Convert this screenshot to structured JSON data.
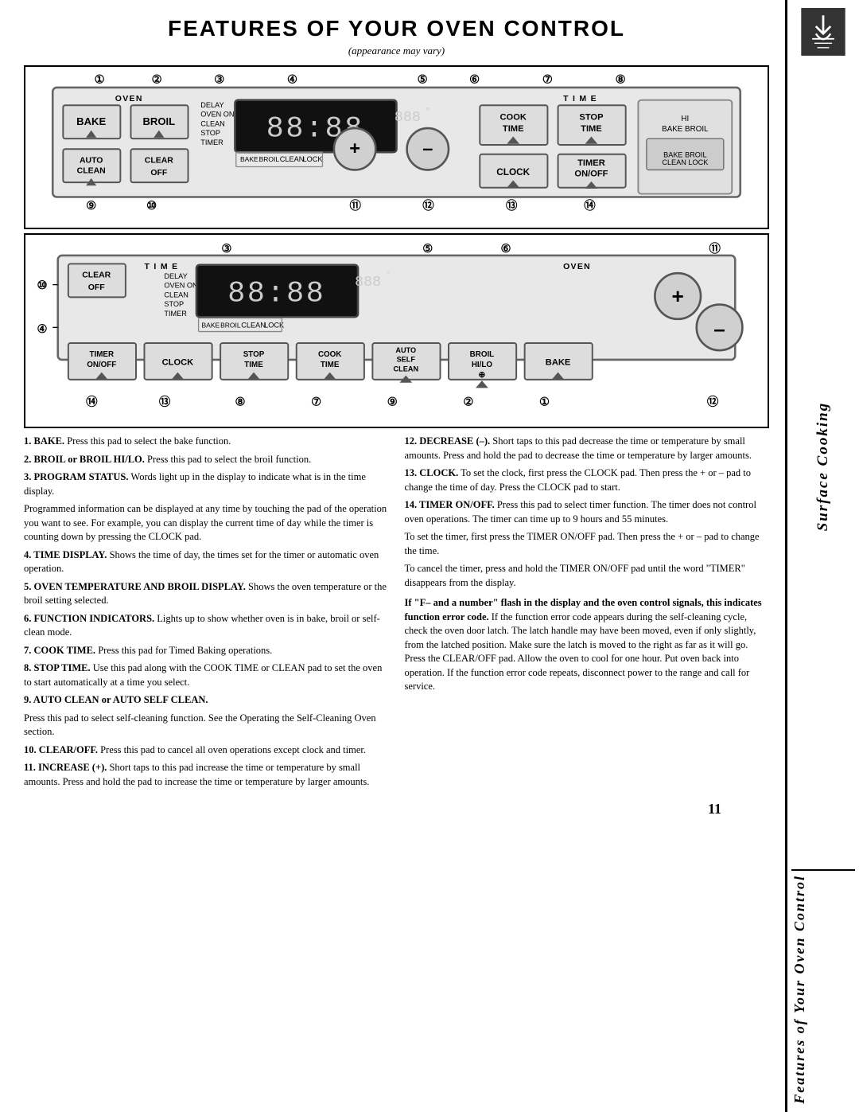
{
  "title": "FEATURES OF YOUR OVEN CONTROL",
  "subtitle": "(appearance may vary)",
  "sidebar": {
    "top_label": "Surface Cooking",
    "bottom_label": "Features of Your Oven Control"
  },
  "diagram_top": {
    "label_oven": "OVEN",
    "label_time": "TIME",
    "numbers_top": [
      "1",
      "2",
      "3",
      "4",
      "5",
      "6",
      "7",
      "8"
    ],
    "numbers_bottom": [
      "9",
      "10",
      "11",
      "12",
      "13",
      "14"
    ],
    "buttons_left": [
      "BAKE",
      "BROIL",
      "AUTO CLEAN"
    ],
    "btn_clear_off": "CLEAR OFF",
    "display_labels": [
      "DELAY",
      "OVEN ON",
      "CLEAN",
      "STOP",
      "TIMER"
    ],
    "display_text": "88:88 888°",
    "display_labels_right": [
      "BAKE",
      "BROIL",
      "CLEAN",
      "LOCK"
    ],
    "btn_plus": "+",
    "btn_minus": "–",
    "btn_cook_time": "COOK TIME",
    "btn_stop_time": "STOP TIME",
    "btn_clock": "CLOCK",
    "btn_timer": "TIMER ON/OFF"
  },
  "diagram_bottom": {
    "label_time": "TIME",
    "label_oven": "OVEN",
    "numbers_top": [
      "3",
      "5",
      "6",
      "11"
    ],
    "numbers_side_left": [
      "10",
      "4"
    ],
    "numbers_bottom": [
      "14",
      "13",
      "8",
      "7",
      "9",
      "2",
      "1",
      "12"
    ],
    "buttons": [
      "TIMER ON/OFF",
      "CLOCK",
      "STOP TIME",
      "COOK TIME",
      "AUTO SELF CLEAN",
      "BROIL HI/LO",
      "BAKE"
    ],
    "btn_clear_off": "CLEAR OFF",
    "display_labels": [
      "DELAY",
      "OVEN ON",
      "CLEAN",
      "STOP",
      "TIMER"
    ],
    "display_text": "88:88 888°",
    "display_labels_right": [
      "BAKE",
      "BROIL",
      "CLEAN",
      "LOCK"
    ],
    "btn_plus": "+",
    "btn_minus": "–"
  },
  "descriptions": [
    {
      "number": "1",
      "title": "BAKE.",
      "text": "Press this pad to select the bake function."
    },
    {
      "number": "2",
      "title": "BROIL or BROIL HI/LO.",
      "text": "Press this pad to select the broil function."
    },
    {
      "number": "3",
      "title": "PROGRAM STATUS.",
      "text": "Words light up in the display to indicate what is in the time display."
    },
    {
      "number": "3b",
      "title": "",
      "text": "Programmed information can be displayed at any time by touching the pad of the operation you want to see. For example, you can display the current time of day while the timer is counting down by pressing the CLOCK pad."
    },
    {
      "number": "4",
      "title": "TIME DISPLAY.",
      "text": "Shows the time of day, the times set for the timer or automatic oven operation."
    },
    {
      "number": "5",
      "title": "OVEN TEMPERATURE AND BROIL DISPLAY.",
      "text": "Shows the oven temperature or the broil setting selected."
    },
    {
      "number": "6",
      "title": "FUNCTION INDICATORS.",
      "text": "Lights up to show whether oven is in bake, broil or self-clean mode."
    },
    {
      "number": "7",
      "title": "COOK TIME.",
      "text": "Press this pad for Timed Baking operations."
    },
    {
      "number": "8",
      "title": "STOP TIME.",
      "text": "Use this pad along with the COOK TIME or CLEAN pad to set the oven to start automatically at a time you select."
    },
    {
      "number": "9",
      "title": "AUTO CLEAN or AUTO SELF CLEAN.",
      "text": "Press this pad to select self-cleaning function. See the Operating the Self-Cleaning Oven section."
    },
    {
      "number": "10",
      "title": "CLEAR/OFF.",
      "text": "Press this pad to cancel all oven operations except clock and timer."
    },
    {
      "number": "11",
      "title": "INCREASE (+).",
      "text": "Short taps to this pad increase the time or temperature by small amounts. Press and hold the pad to increase the time or temperature by larger amounts."
    }
  ],
  "descriptions_right": [
    {
      "number": "12",
      "title": "DECREASE (–).",
      "text": "Short taps to this pad decrease the time or temperature by small amounts. Press and hold the pad to decrease the time or temperature by larger amounts."
    },
    {
      "number": "13",
      "title": "CLOCK.",
      "text": "To set the clock, first press the CLOCK pad. Then press the + or – pad to change the time of day. Press the CLOCK pad to start."
    },
    {
      "number": "14",
      "title": "TIMER ON/OFF.",
      "text": "Press this pad to select timer function. The timer does not control oven operations. The timer can time up to 9 hours and 55 minutes."
    },
    {
      "number": "14b",
      "title": "",
      "text": "To set the timer, first press the TIMER ON/OFF pad. Then press the + or – pad to change the time."
    },
    {
      "number": "14c",
      "title": "",
      "text": "To cancel the timer, press and hold the TIMER ON/OFF pad until the word \"TIMER\" disappears from the display."
    },
    {
      "number": "error",
      "title": "If \"F– and a number\" flash in the display and the oven control signals, this indicates function error code.",
      "text": "If the function error code appears during the self-cleaning cycle, check the oven door latch. The latch handle may have been moved, even if only slightly, from the latched position. Make sure the latch is moved to the right as far as it will go. Press the CLEAR/OFF pad. Allow the oven to cool for one hour. Put oven back into operation. If the function error code repeats, disconnect power to the range and call for service."
    }
  ],
  "page_number": "11"
}
